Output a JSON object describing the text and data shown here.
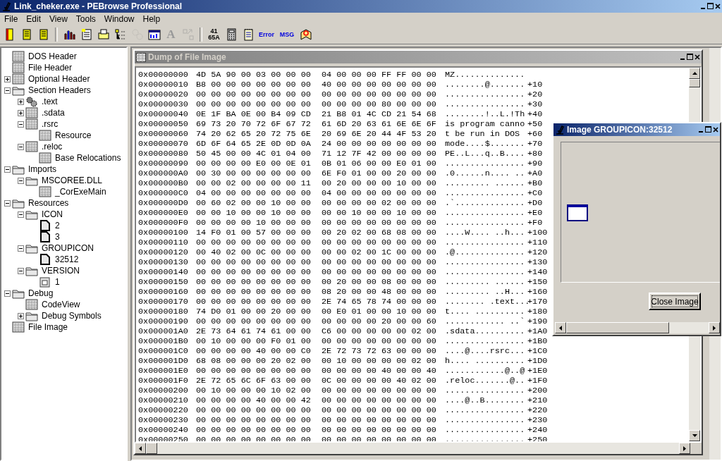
{
  "window": {
    "title": "Link_cheker.exe - PEBrowse Professional"
  },
  "menu": [
    "File",
    "Edit",
    "View",
    "Tools",
    "Window",
    "Help"
  ],
  "toolbar": [
    {
      "kind": "icon"
    },
    {
      "kind": "icon"
    },
    {
      "kind": "icon"
    },
    {
      "kind": "separator"
    },
    {
      "kind": "icon"
    },
    {
      "kind": "icon"
    },
    {
      "kind": "icon"
    },
    {
      "kind": "icon"
    },
    {
      "kind": "icon",
      "disabled": true
    },
    {
      "kind": "icon"
    },
    {
      "kind": "text",
      "text": "A",
      "disabled": true
    },
    {
      "kind": "icon",
      "disabled": true
    },
    {
      "kind": "separator"
    },
    {
      "kind": "text",
      "text": "41 65A",
      "disabled": false
    },
    {
      "kind": "icon"
    },
    {
      "kind": "icon"
    },
    {
      "kind": "text",
      "text": "Error",
      "disabled": false
    },
    {
      "kind": "text",
      "text": "MSG",
      "disabled": false
    },
    {
      "kind": "icon"
    }
  ],
  "tree": [
    {
      "label": "DOS Header",
      "kind": "node"
    },
    {
      "label": "File Header",
      "kind": "node"
    },
    {
      "label": "Optional Header",
      "kind": "node",
      "expanded": false
    },
    {
      "label": "Section Headers",
      "kind": "folder",
      "expanded": true,
      "children": [
        {
          "label": ".text",
          "kind": "code",
          "expanded": false
        },
        {
          "label": ".sdata",
          "kind": "node",
          "expanded": false
        },
        {
          "label": ".rsrc",
          "kind": "node",
          "expanded": true,
          "children": [
            {
              "label": "Resource",
              "kind": "node"
            }
          ]
        },
        {
          "label": ".reloc",
          "kind": "node",
          "expanded": true,
          "children": [
            {
              "label": "Base Relocations",
              "kind": "node"
            }
          ]
        }
      ]
    },
    {
      "label": "Imports",
      "kind": "folder",
      "expanded": true,
      "children": [
        {
          "label": "MSCOREE.DLL",
          "kind": "folder",
          "expanded": true,
          "children": [
            {
              "label": "_CorExeMain",
              "kind": "node"
            }
          ]
        }
      ]
    },
    {
      "label": "Resources",
      "kind": "folder",
      "expanded": true,
      "children": [
        {
          "label": "ICON",
          "kind": "folder",
          "expanded": true,
          "children": [
            {
              "label": "2",
              "kind": "resource"
            },
            {
              "label": "3",
              "kind": "resource"
            }
          ]
        },
        {
          "label": "GROUPICON",
          "kind": "folder",
          "expanded": true,
          "children": [
            {
              "label": "32512",
              "kind": "resource"
            }
          ]
        },
        {
          "label": "VERSION",
          "kind": "folder",
          "expanded": true,
          "children": [
            {
              "label": "1",
              "kind": "version"
            }
          ]
        }
      ]
    },
    {
      "label": "Debug",
      "kind": "folder",
      "expanded": true,
      "children": [
        {
          "label": "CodeView",
          "kind": "node"
        },
        {
          "label": "Debug Symbols",
          "kind": "folder",
          "expanded": false
        }
      ]
    },
    {
      "label": "File Image",
      "kind": "node"
    }
  ],
  "dump_window": {
    "title": "Dump of File Image",
    "rows": [
      {
        "offset": "0x00000000",
        "bytes_1": "4D 5A 90 00 03 00 00 00",
        "bytes_2": "04 00 00 00 FF FF 00 00",
        "ascii": "MZ.............."
      },
      {
        "offset": "0x00000010",
        "bytes_1": "B8 00 00 00 00 00 00 00",
        "bytes_2": "40 00 00 00 00 00 00 00",
        "ascii": "........@.......",
        "marker": "+10"
      },
      {
        "offset": "0x00000020",
        "bytes_1": "00 00 00 00 00 00 00 00",
        "bytes_2": "00 00 00 00 00 00 00 00",
        "ascii": "................",
        "marker": "+20"
      },
      {
        "offset": "0x00000030",
        "bytes_1": "00 00 00 00 00 00 00 00",
        "bytes_2": "00 00 00 00 80 00 00 00",
        "ascii": "................",
        "marker": "+30"
      },
      {
        "offset": "0x00000040",
        "bytes_1": "0E 1F BA 0E 00 B4 09 CD",
        "bytes_2": "21 B8 01 4C CD 21 54 68",
        "ascii": "........!..L.!Th",
        "marker": "+40"
      },
      {
        "offset": "0x00000050",
        "bytes_1": "69 73 20 70 72 6F 67 72",
        "bytes_2": "61 6D 20 63 61 6E 6E 6F",
        "ascii": "is program canno",
        "marker": "+50"
      },
      {
        "offset": "0x00000060",
        "bytes_1": "74 20 62 65 20 72 75 6E",
        "bytes_2": "20 69 6E 20 44 4F 53 20",
        "ascii": "t be run in DOS ",
        "marker": "+60"
      },
      {
        "offset": "0x00000070",
        "bytes_1": "6D 6F 64 65 2E 0D 0D 0A",
        "bytes_2": "24 00 00 00 00 00 00 00",
        "ascii": "mode....$.......",
        "marker": "+70"
      },
      {
        "offset": "0x00000080",
        "bytes_1": "50 45 00 00 4C 01 04 00",
        "bytes_2": "71 12 7F 42 00 00 00 00",
        "ascii": "PE..L...q..B....",
        "marker": "+80"
      },
      {
        "offset": "0x00000090",
        "bytes_1": "00 00 00 00 E0 00 0E 01",
        "bytes_2": "0B 01 06 00 00 E0 01 00",
        "ascii": "................",
        "marker": "+90"
      },
      {
        "offset": "0x000000A0",
        "bytes_1": "00 30 00 00 00 00 00 00",
        "bytes_2": "6E F0 01 00 00 20 00 00",
        "ascii": ".0......n.... ..",
        "marker": "+A0"
      },
      {
        "offset": "0x000000B0",
        "bytes_1": "00 00 02 00 00 00 00 11",
        "bytes_2": "00 20 00 00 00 10 00 00",
        "ascii": "......... ......",
        "marker": "+B0"
      },
      {
        "offset": "0x000000C0",
        "bytes_1": "04 00 00 00 00 00 00 00",
        "bytes_2": "04 00 00 00 00 00 00 00",
        "ascii": "................",
        "marker": "+C0"
      },
      {
        "offset": "0x000000D0",
        "bytes_1": "00 60 02 00 00 10 00 00",
        "bytes_2": "00 00 00 00 02 00 00 00",
        "ascii": ".`..............",
        "marker": "+D0"
      },
      {
        "offset": "0x000000E0",
        "bytes_1": "00 00 10 00 00 10 00 00",
        "bytes_2": "00 00 10 00 00 10 00 00",
        "ascii": "................",
        "marker": "+E0"
      },
      {
        "offset": "0x000000F0",
        "bytes_1": "00 00 00 00 10 00 00 00",
        "bytes_2": "00 00 00 00 00 00 00 00",
        "ascii": "................",
        "marker": "+F0"
      },
      {
        "offset": "0x00000100",
        "bytes_1": "14 F0 01 00 57 00 00 00",
        "bytes_2": "00 20 02 00 68 08 00 00",
        "ascii": "....W.... ..h...",
        "marker": "+100"
      },
      {
        "offset": "0x00000110",
        "bytes_1": "00 00 00 00 00 00 00 00",
        "bytes_2": "00 00 00 00 00 00 00 00",
        "ascii": "................",
        "marker": "+110"
      },
      {
        "offset": "0x00000120",
        "bytes_1": "00 40 02 00 0C 00 00 00",
        "bytes_2": "00 00 02 00 1C 00 00 00",
        "ascii": ".@..............",
        "marker": "+120"
      },
      {
        "offset": "0x00000130",
        "bytes_1": "00 00 00 00 00 00 00 00",
        "bytes_2": "00 00 00 00 00 00 00 00",
        "ascii": "................",
        "marker": "+130"
      },
      {
        "offset": "0x00000140",
        "bytes_1": "00 00 00 00 00 00 00 00",
        "bytes_2": "00 00 00 00 00 00 00 00",
        "ascii": "................",
        "marker": "+140"
      },
      {
        "offset": "0x00000150",
        "bytes_1": "00 00 00 00 00 00 00 00",
        "bytes_2": "00 20 00 00 08 00 00 00",
        "ascii": "......... ......",
        "marker": "+150"
      },
      {
        "offset": "0x00000160",
        "bytes_1": "00 00 00 00 00 00 00 00",
        "bytes_2": "08 20 00 00 48 00 00 00",
        "ascii": "......... ..H...",
        "marker": "+160"
      },
      {
        "offset": "0x00000170",
        "bytes_1": "00 00 00 00 00 00 00 00",
        "bytes_2": "2E 74 65 78 74 00 00 00",
        "ascii": "........ .text...",
        "marker": "+170"
      },
      {
        "offset": "0x00000180",
        "bytes_1": "74 D0 01 00 00 20 00 00",
        "bytes_2": "00 E0 01 00 00 10 00 00",
        "ascii": "t.... ..........",
        "marker": "+180"
      },
      {
        "offset": "0x00000190",
        "bytes_1": "00 00 00 00 00 00 00 00",
        "bytes_2": "00 00 00 00 20 00 00 60",
        "ascii": "............ ..`",
        "marker": "+190"
      },
      {
        "offset": "0x000001A0",
        "bytes_1": "2E 73 64 61 74 61 00 00",
        "bytes_2": "C6 00 00 00 00 00 02 00",
        "ascii": ".sdata..........",
        "marker": "+1A0"
      },
      {
        "offset": "0x000001B0",
        "bytes_1": "00 10 00 00 00 F0 01 00",
        "bytes_2": "00 00 00 00 00 00 00 00",
        "ascii": "................",
        "marker": "+1B0"
      },
      {
        "offset": "0x000001C0",
        "bytes_1": "00 00 00 00 40 00 00 C0",
        "bytes_2": "2E 72 73 72 63 00 00 00",
        "ascii": "....@....rsrc...",
        "marker": "+1C0"
      },
      {
        "offset": "0x000001D0",
        "bytes_1": "68 08 00 00 00 20 02 00",
        "bytes_2": "00 10 00 00 00 00 02 00",
        "ascii": "h.... ..........",
        "marker": "+1D0"
      },
      {
        "offset": "0x000001E0",
        "bytes_1": "00 00 00 00 00 00 00 00",
        "bytes_2": "00 00 00 00 40 00 00 40",
        "ascii": "............@..@",
        "marker": "+1E0"
      },
      {
        "offset": "0x000001F0",
        "bytes_1": "2E 72 65 6C 6F 63 00 00",
        "bytes_2": "0C 00 00 00 00 40 02 00",
        "ascii": ".reloc.......@..",
        "marker": "+1F0"
      },
      {
        "offset": "0x00000200",
        "bytes_1": "00 10 00 00 00 10 02 00",
        "bytes_2": "00 00 00 00 00 00 00 00",
        "ascii": "................",
        "marker": "+200"
      },
      {
        "offset": "0x00000210",
        "bytes_1": "00 00 00 00 40 00 00 42",
        "bytes_2": "00 00 00 00 00 00 00 00",
        "ascii": "....@..B........",
        "marker": "+210"
      },
      {
        "offset": "0x00000220",
        "bytes_1": "00 00 00 00 00 00 00 00",
        "bytes_2": "00 00 00 00 00 00 00 00",
        "ascii": "................",
        "marker": "+220"
      },
      {
        "offset": "0x00000230",
        "bytes_1": "00 00 00 00 00 00 00 00",
        "bytes_2": "00 00 00 00 00 00 00 00",
        "ascii": "................",
        "marker": "+230"
      },
      {
        "offset": "0x00000240",
        "bytes_1": "00 00 00 00 00 00 00 00",
        "bytes_2": "00 00 00 00 00 00 00 00",
        "ascii": "................",
        "marker": "+240"
      },
      {
        "offset": "0x00000250",
        "bytes_1": "00 00 00 00 00 00 00 00",
        "bytes_2": "00 00 00 00 00 00 00 00",
        "ascii": "................",
        "marker": "+250"
      }
    ]
  },
  "image_window": {
    "title": "Image GROUPICON:32512",
    "button": "Close Image"
  }
}
